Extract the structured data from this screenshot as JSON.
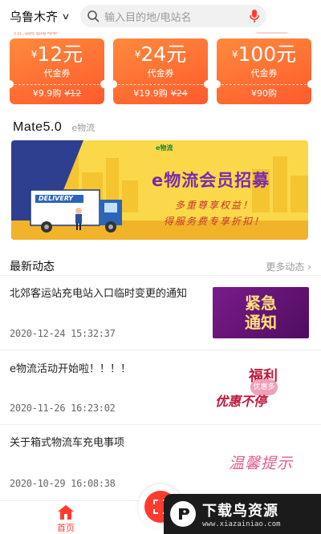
{
  "header": {
    "city": "乌鲁木齐",
    "search_placeholder": "输入目的地/电站名"
  },
  "faded_section_label": "优惠购券",
  "coupons": [
    {
      "currency": "¥",
      "amount": "12元",
      "kind": "代金券",
      "price": "¥9.9购",
      "original": "¥12"
    },
    {
      "currency": "¥",
      "amount": "24元",
      "kind": "代金券",
      "price": "¥19.9购",
      "original": "¥24"
    },
    {
      "currency": "¥",
      "amount": "100元",
      "kind": "代金券",
      "price": "¥90购",
      "original": ""
    }
  ],
  "section": {
    "title": "Mate5.0",
    "subtitle": "e物流"
  },
  "banner": {
    "logo": "e物流",
    "title": "e物流会员招募",
    "line1": "多重尊享权益！",
    "line2": "得服务费专享折扣！",
    "truck_text": "DELIVERY"
  },
  "news": {
    "title": "最新动态",
    "more": "更多动态",
    "items": [
      {
        "title": "北郊客运站充电站入口临时变更的通知",
        "date": "2020-12-24 15:32:37",
        "thumb": [
          "紧急",
          "通知"
        ]
      },
      {
        "title": "e物流活动开始啦！！！！",
        "date": "2020-11-26 16:23:02",
        "thumb": [
          "福利",
          "优惠多",
          "优惠不停"
        ]
      },
      {
        "title": "关于箱式物流车充电事项",
        "date": "2020-10-29 16:08:38",
        "thumb": [
          "温馨提示"
        ]
      }
    ]
  },
  "tabbar": {
    "home": "首页"
  },
  "watermark": {
    "name": "下载鸟资源",
    "url": "www.xiazainiao.com"
  },
  "colors": {
    "accent": "#ff3b30",
    "coupon": "#ff6a30",
    "banner": "#fbd84a",
    "banner_title": "#7a2ba8"
  }
}
